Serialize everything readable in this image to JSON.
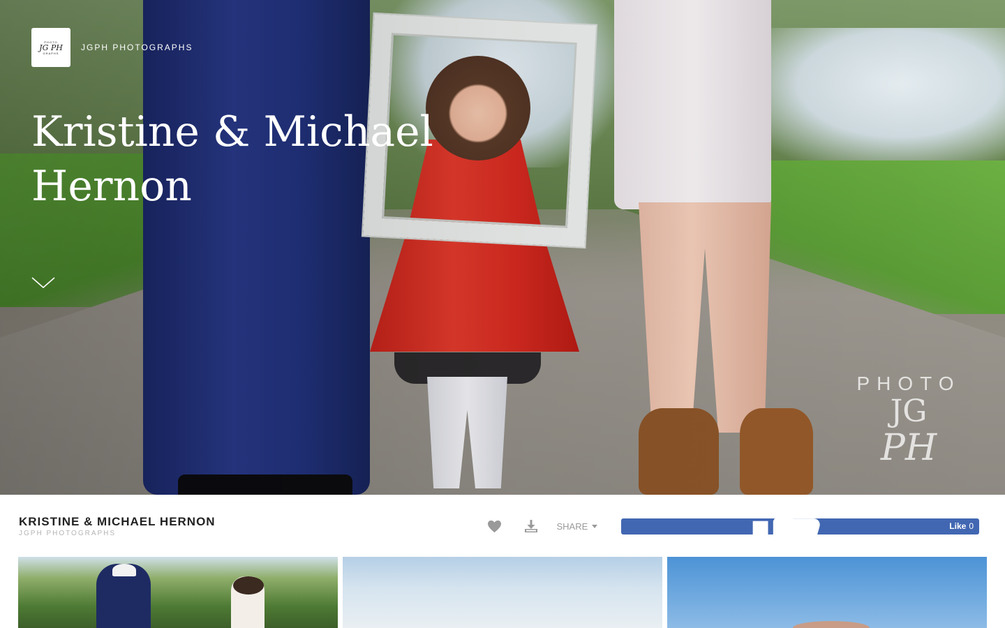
{
  "brand": {
    "logo_line1": "PHOTO",
    "logo_line2": "JG PH",
    "logo_line3": "GRAPHS",
    "name": "JGPH PHOTOGRAPHS"
  },
  "hero": {
    "title": "Kristine & Michael Hernon",
    "scroll_icon": "chevron-down-icon",
    "watermark": {
      "line1": "PHOTO",
      "line2": "JG",
      "line3": "PH"
    }
  },
  "gallery": {
    "title": "KRISTINE & MICHAEL HERNON",
    "subtitle": "JGPH PHOTOGRAPHS"
  },
  "actions": {
    "favorite_icon": "heart-icon",
    "download_icon": "download-icon",
    "share_label": "SHARE",
    "like_label": "Like",
    "like_count": "0"
  },
  "colors": {
    "facebook_blue": "#4267b2",
    "title_text": "#222222",
    "muted_text": "#b4b4b4",
    "icon_gray": "#9a9a9a"
  }
}
